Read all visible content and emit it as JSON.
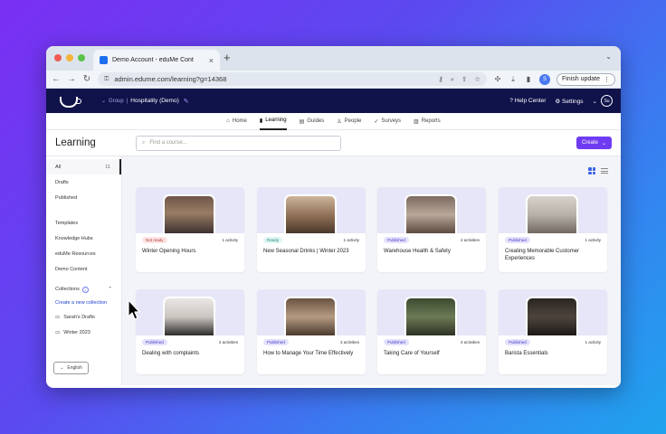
{
  "browser": {
    "tab_title": "Demo Account - eduMe Cont",
    "url": "admin.edume.com/learning?g=14368",
    "profile_initial": "S",
    "update_label": "Finish update"
  },
  "app": {
    "group_label": "Group",
    "group_name": "Hospitality (Demo)",
    "help_label": "Help Center",
    "settings_label": "Settings",
    "user_initials": "Su"
  },
  "nav": {
    "home": "Home",
    "learning": "Learning",
    "guides": "Guides",
    "people": "People",
    "surveys": "Surveys",
    "reports": "Reports"
  },
  "page": {
    "title": "Learning",
    "search_placeholder": "Find a course...",
    "create_label": "Create"
  },
  "sidebar": {
    "all": "All",
    "all_count": "11",
    "drafts": "Drafts",
    "published": "Published",
    "templates": "Templates",
    "knowledge_hubs": "Knowledge Hubs",
    "edume_resources": "eduMe Resources",
    "demo_content": "Demo Content",
    "collections": "Collections",
    "create_collection": "Create a new collection",
    "collection_1": "Sarah's Drafts",
    "collection_2": "Winter 2023",
    "language": "English"
  },
  "cards": [
    {
      "badge": "Not ready",
      "badge_type": "nr",
      "activities": "1 activity",
      "title": "Winter Opening Hours"
    },
    {
      "badge": "Ready",
      "badge_type": "dr",
      "activities": "1 activity",
      "title": "New Seasonal Drinks | Winter 2023"
    },
    {
      "badge": "Published",
      "badge_type": "pb",
      "activities": "4 activities",
      "title": "Warehouse Health & Safety"
    },
    {
      "badge": "Published",
      "badge_type": "pb",
      "activities": "1 activity",
      "title": "Creating Memorable Customer Experiences"
    },
    {
      "badge": "Published",
      "badge_type": "pb",
      "activities": "2 activities",
      "title": "Dealing with complaints"
    },
    {
      "badge": "Published",
      "badge_type": "pb",
      "activities": "3 activities",
      "title": "How to Manage Your Time Effectively"
    },
    {
      "badge": "Published",
      "badge_type": "pb",
      "activities": "4 activities",
      "title": "Taking Care of Yourself"
    },
    {
      "badge": "Published",
      "badge_type": "pb",
      "activities": "1 activity",
      "title": "Barista Essentials"
    }
  ],
  "colors": {
    "app_header": "#10124a",
    "accent": "#6e3bf3",
    "card_image_bg": "#e6e6f8"
  }
}
